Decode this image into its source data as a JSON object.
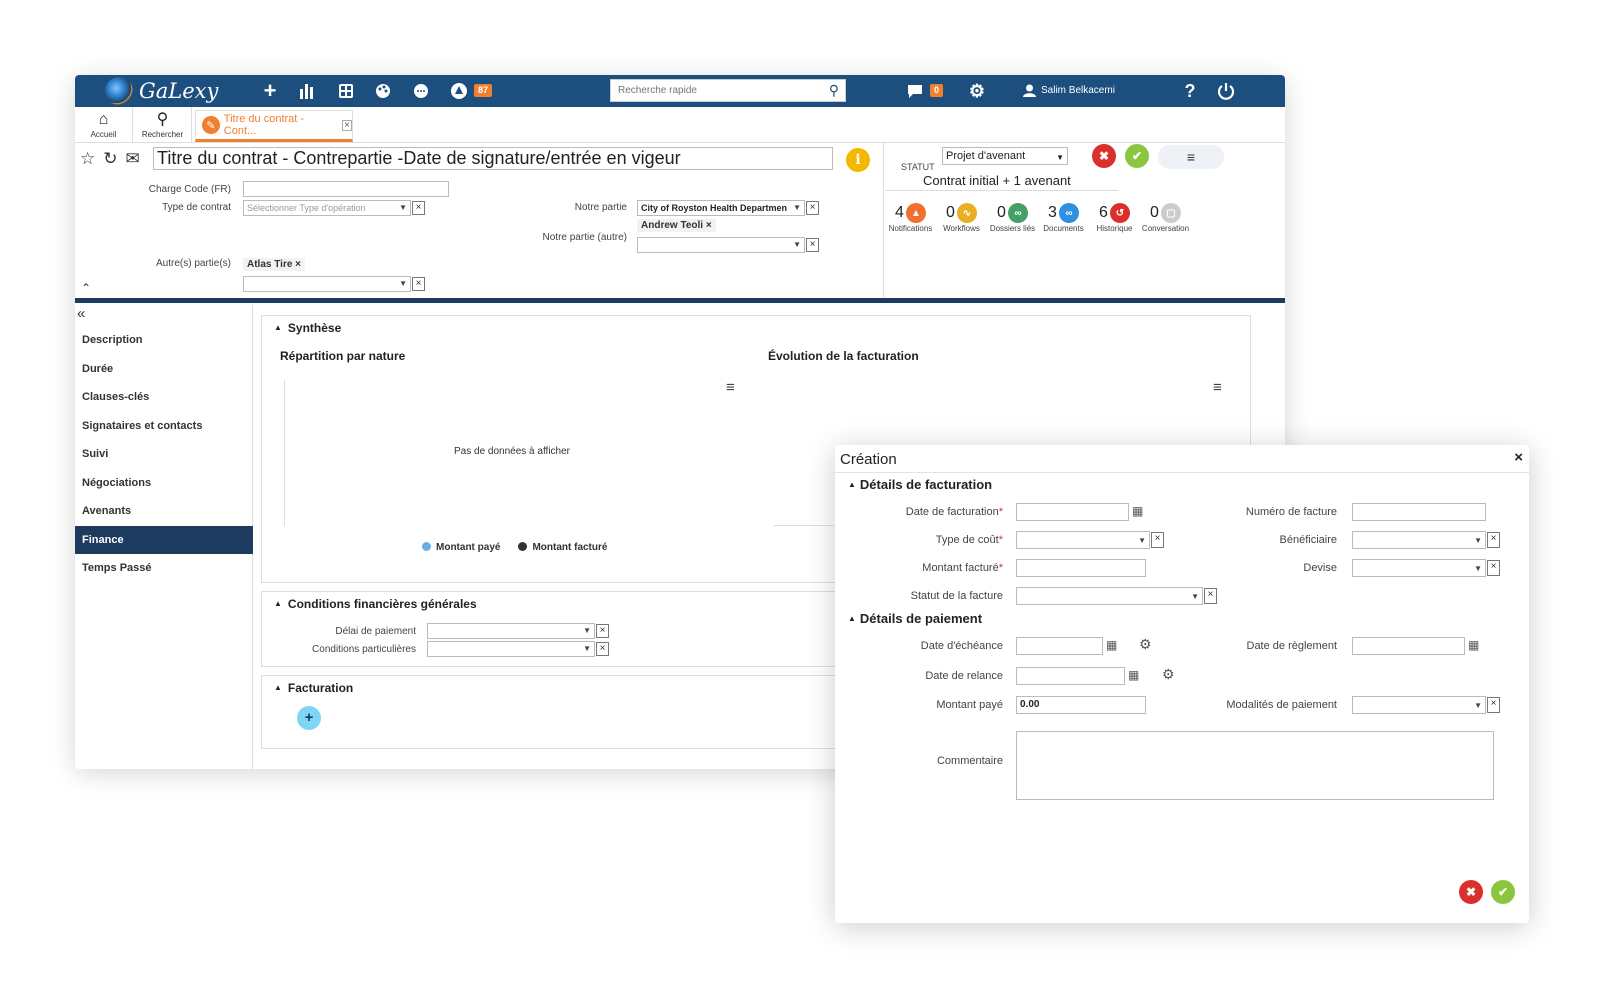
{
  "app": {
    "logo_text": "GaLexy",
    "notifications_badge": "87",
    "messages_badge": "0",
    "search_placeholder": "Recherche rapide",
    "user_name": "Salim Belkacemi",
    "help_label": "?"
  },
  "tabs": {
    "home_label": "Accueil",
    "search_label": "Rechercher",
    "document_tab_label": "Titre du contrat - Cont..."
  },
  "header": {
    "title": "Titre du contrat - Contrepartie -Date de signature/entrée en vigeur",
    "info_label": "i",
    "fields": {
      "charge_code_label": "Charge Code (FR)",
      "contract_type_label": "Type de contrat",
      "contract_type_placeholder": "Sélectionner Type d'opération",
      "our_party_label": "Notre partie",
      "our_party_value": "City of Royston Health Departmen",
      "our_party_other_label": "Notre partie (autre)",
      "our_party_other_tag": "Andrew Teoli",
      "other_parties_label": "Autre(s) partie(s)",
      "other_parties_tag": "Atlas Tire"
    },
    "status_label": "STATUT",
    "status_value": "Projet d'avenant",
    "contract_type_text": "Contrat initial + 1 avenant",
    "counters": [
      {
        "count": "4",
        "label": "Notifications",
        "color": "#f07030"
      },
      {
        "count": "0",
        "label": "Workflows",
        "color": "#e8b020"
      },
      {
        "count": "0",
        "label": "Dossiers liés",
        "color": "#46a066"
      },
      {
        "count": "3",
        "label": "Documents",
        "color": "#2f8fe0"
      },
      {
        "count": "6",
        "label": "Historique",
        "color": "#d9302c"
      },
      {
        "count": "0",
        "label": "Conversation",
        "color": "#bbbbbb"
      }
    ]
  },
  "sidebar": {
    "items": [
      {
        "label": "Description"
      },
      {
        "label": "Durée"
      },
      {
        "label": "Clauses-clés"
      },
      {
        "label": "Signataires et contacts"
      },
      {
        "label": "Suivi"
      },
      {
        "label": "Négociations"
      },
      {
        "label": "Avenants"
      },
      {
        "label": "Finance"
      },
      {
        "label": "Temps Passé"
      }
    ],
    "active": "Finance"
  },
  "synthese": {
    "title": "Synthèse",
    "chart1_title": "Répartition par nature",
    "chart2_title": "Évolution de la facturation",
    "no_data": "Pas de données à afficher",
    "legend": [
      {
        "label": "Montant payé",
        "color": "#6aaee8"
      },
      {
        "label": "Montant facturé",
        "color": "#333333"
      }
    ]
  },
  "conditions": {
    "title": "Conditions financières générales",
    "payment_delay_label": "Délai de paiement",
    "special_conditions_label": "Conditions particulières"
  },
  "facturation": {
    "title": "Facturation"
  },
  "modal": {
    "title": "Création",
    "billing_section": "Détails de facturation",
    "payment_section": "Détails de paiement",
    "billing_date_label": "Date de facturation",
    "invoice_number_label": "Numéro de facture",
    "cost_type_label": "Type de coût",
    "beneficiary_label": "Bénéficiaire",
    "billed_amount_label": "Montant facturé",
    "currency_label": "Devise",
    "invoice_status_label": "Statut de la facture",
    "due_date_label": "Date d'échéance",
    "settlement_date_label": "Date de règlement",
    "reminder_date_label": "Date de relance",
    "paid_amount_label": "Montant payé",
    "paid_amount_value": "0.00",
    "payment_terms_label": "Modalités de paiement",
    "comment_label": "Commentaire",
    "required_marker": "*"
  }
}
